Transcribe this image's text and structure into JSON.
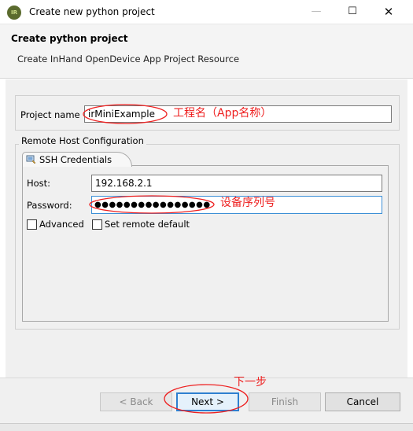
{
  "window": {
    "title": "Create new python project",
    "icon_name": "pydev-icon",
    "icon_text": "IR",
    "controls": {
      "minimize_icon": "—",
      "maximize_icon": "☐",
      "close_icon": "✕"
    }
  },
  "header": {
    "title": "Create python project",
    "subtitle": "Create InHand OpenDevice App Project Resource"
  },
  "project": {
    "label": "Project name",
    "value": "irMiniExample"
  },
  "remote": {
    "group_label": "Remote Host Configuration",
    "tab_label": "SSH Credentials",
    "host_label": "Host:",
    "host_value": "192.168.2.1",
    "password_label": "Password:",
    "password_mask": "●●●●●●●●●●●●●●●●",
    "advanced_label": "Advanced",
    "advanced_checked": false,
    "remote_default_label": "Set remote default",
    "remote_default_checked": false
  },
  "buttons": {
    "back": "< Back",
    "next": "Next >",
    "finish": "Finish",
    "cancel": "Cancel"
  },
  "annotations": {
    "project_name_note": "工程名（App名称）",
    "password_note": "设备序列号",
    "next_note": "下一步",
    "color": "#ee2020"
  }
}
